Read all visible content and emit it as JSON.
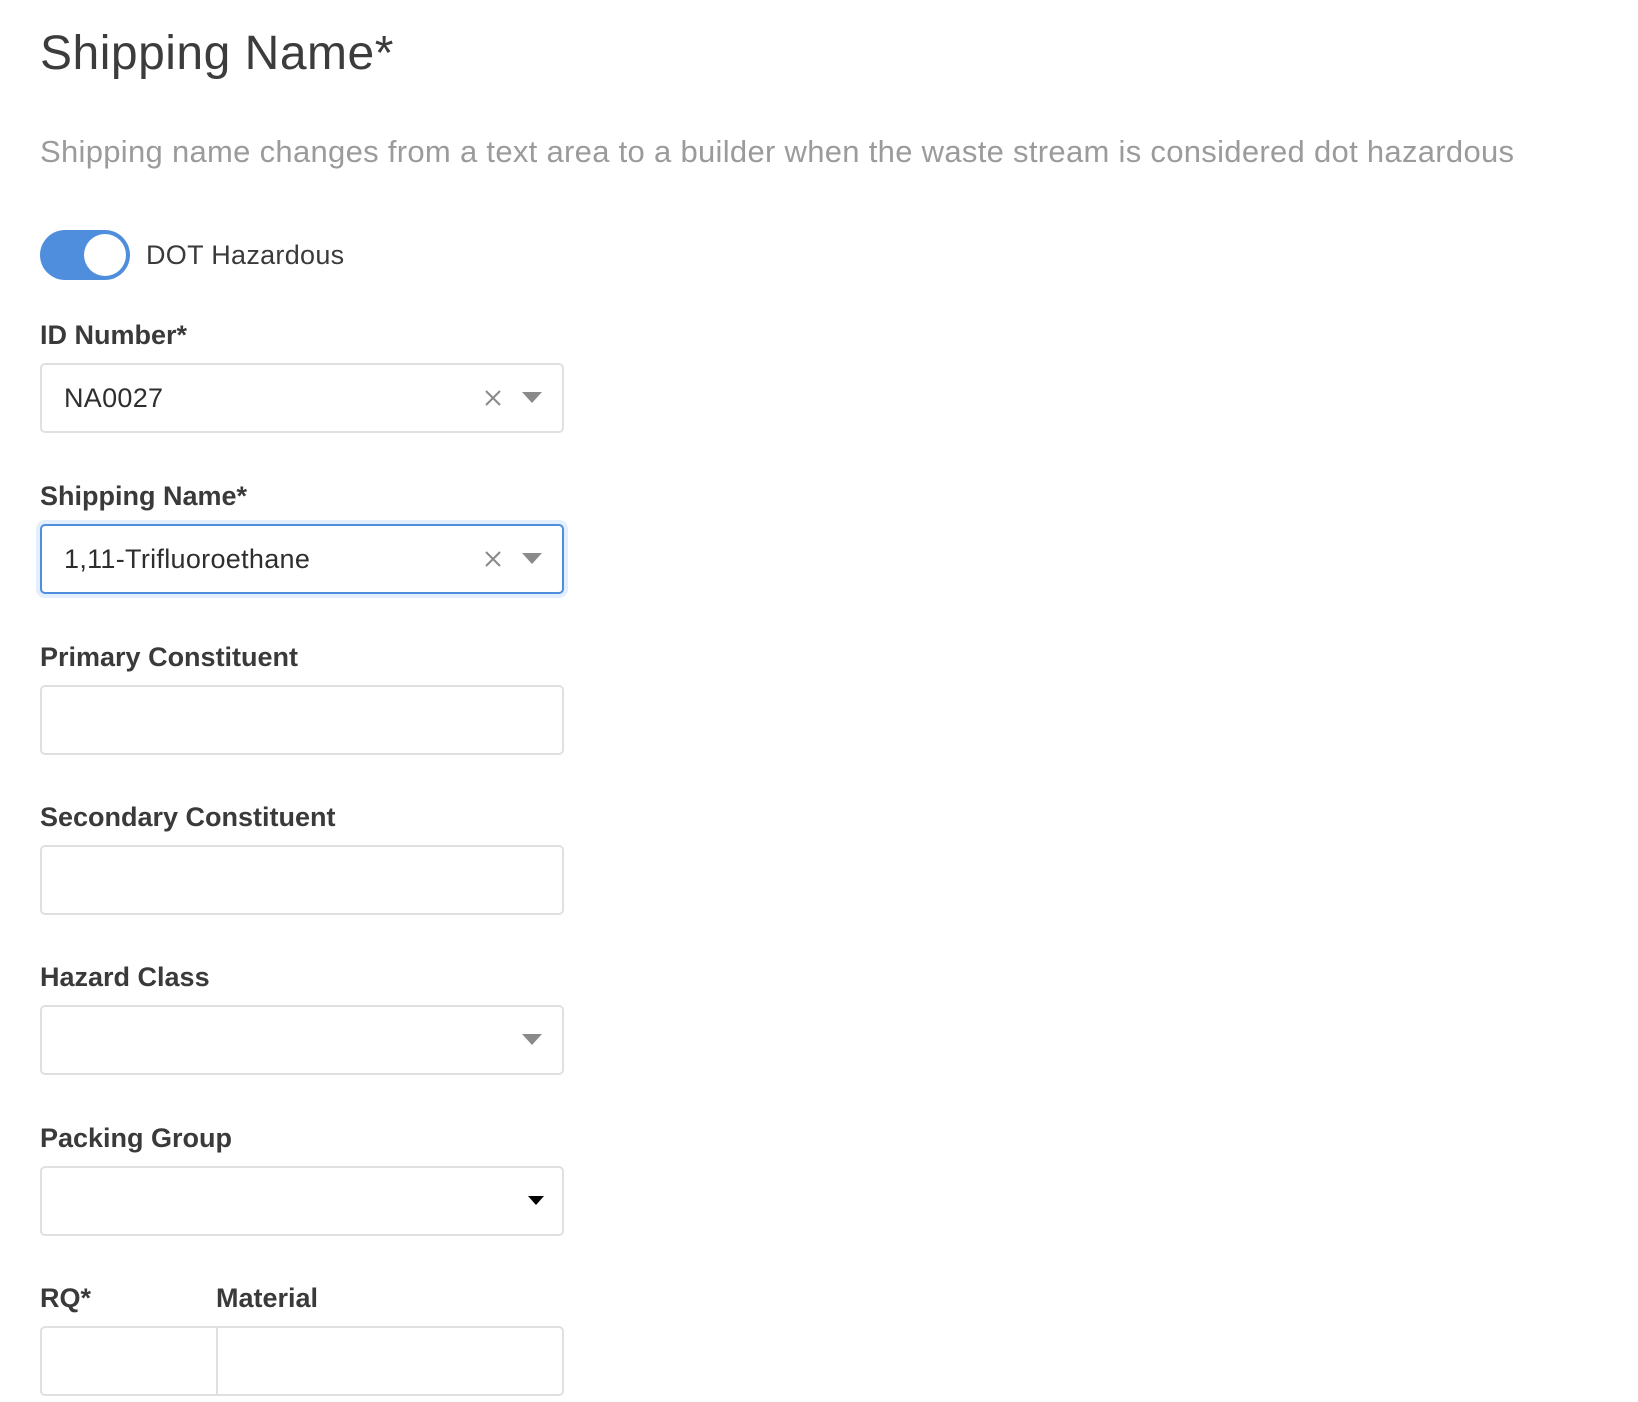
{
  "section": {
    "title": "Shipping Name*",
    "description": "Shipping name changes from a text area to a builder when the waste stream is considered dot hazardous"
  },
  "toggle": {
    "label": "DOT Hazardous",
    "on": true,
    "color": "#4f8edc"
  },
  "fields": {
    "id_number": {
      "label": "ID Number*",
      "value": "NA0027"
    },
    "shipping_name": {
      "label": "Shipping Name*",
      "value": "1,11-Trifluoroethane"
    },
    "primary_constituent": {
      "label": "Primary Constituent",
      "value": ""
    },
    "secondary_constituent": {
      "label": "Secondary Constituent",
      "value": ""
    },
    "hazard_class": {
      "label": "Hazard Class",
      "value": ""
    },
    "packing_group": {
      "label": "Packing Group",
      "value": ""
    },
    "rq": {
      "label": "RQ*",
      "value": ""
    },
    "material": {
      "label": "Material",
      "value": ""
    }
  },
  "icons": {
    "clear": "close-icon",
    "dropdown": "chevron-down-icon",
    "caret": "caret-down-icon"
  },
  "colors": {
    "accent": "#4f8edc",
    "focus_ring": "#e3effc",
    "border": "#e0e0e0",
    "muted_text": "#9b9b9b"
  }
}
